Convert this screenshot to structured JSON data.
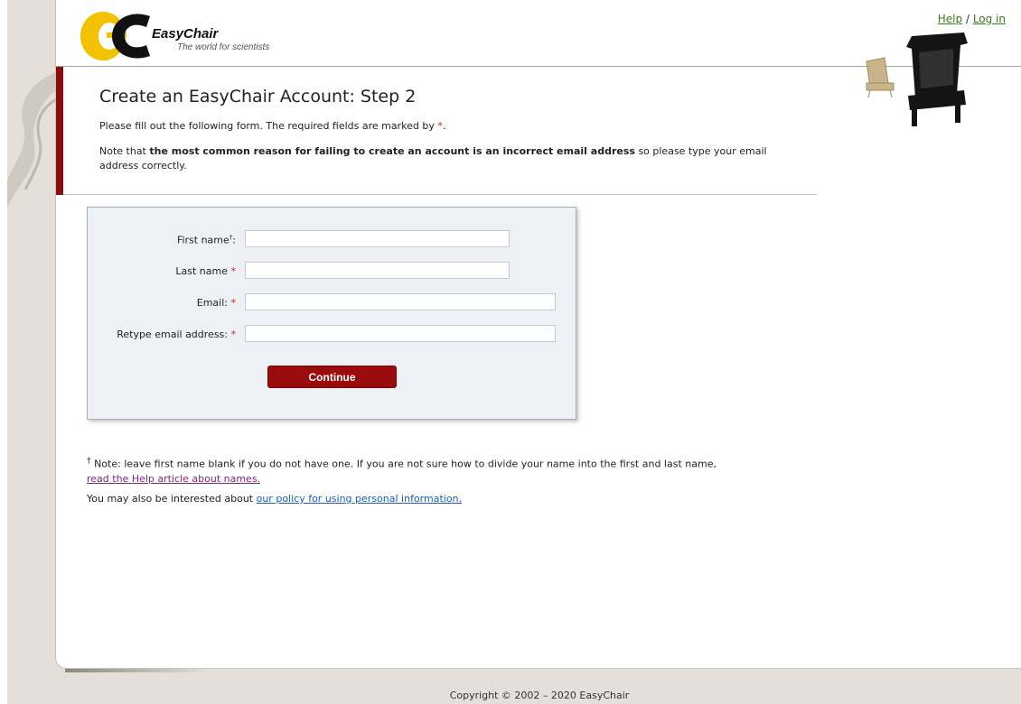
{
  "header": {
    "logo_name": "EasyChair",
    "logo_tagline": "The world for scientists",
    "help_link": "Help",
    "separator": "/",
    "login_link": "Log in"
  },
  "page": {
    "title": "Create an EasyChair Account: Step 2",
    "intro_text": "Please fill out the following form. The required fields are marked by",
    "required_marker": "*",
    "intro_end": ".",
    "note_prefix": "Note that",
    "note_bold": "the most common reason for failing to create an account is an incorrect email address",
    "note_suffix": "so please type your email address correctly."
  },
  "form": {
    "first_name_label": "First name",
    "first_name_dagger": "†",
    "first_name_colon": ":",
    "first_name_value": "",
    "last_name_label": "Last name",
    "last_name_value": "",
    "email_label": "Email:",
    "email_value": "",
    "retype_email_label": "Retype email address:",
    "retype_email_value": "",
    "required_marker": "*",
    "continue_label": "Continue"
  },
  "footnote": {
    "dagger": "†",
    "text": "Note: leave first name blank if you do not have one. If you are not sure how to divide your name into the first and last name,",
    "link": "read the Help article about names."
  },
  "policy": {
    "text": "You may also be interested about",
    "link": "our policy for using personal information."
  },
  "footer": {
    "copyright": "Copyright © 2002 – 2020 EasyChair"
  },
  "colors": {
    "accent_red": "#8b0d0d",
    "button_red": "#9a0b0b",
    "required_red": "#d42020",
    "link_green": "#3a7a1a",
    "link_blue": "#1a5fb4",
    "form_bg": "#edf0f5"
  }
}
